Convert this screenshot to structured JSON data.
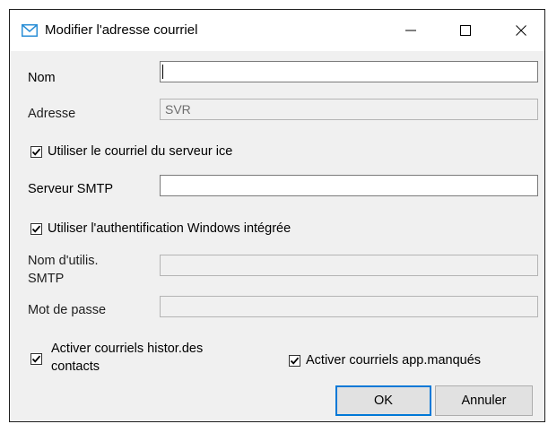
{
  "window": {
    "title": "Modifier l'adresse courriel",
    "controls": {
      "minimize": "minimize-icon",
      "maximize": "maximize-icon",
      "close": "close-icon"
    }
  },
  "form": {
    "nom": {
      "label": "Nom",
      "value": ""
    },
    "adresse": {
      "label": "Adresse",
      "value": "SVR"
    },
    "use_ice_server": {
      "label": "Utiliser le courriel du serveur ice",
      "checked": true
    },
    "smtp_server": {
      "label": "Serveur SMTP",
      "value": ""
    },
    "use_windows_auth": {
      "label": "Utiliser l'authentification Windows intégrée",
      "checked": true
    },
    "smtp_user": {
      "label_line1": "Nom d'utilis.",
      "label_line2": "SMTP",
      "value": ""
    },
    "password": {
      "label": "Mot de passe",
      "value": ""
    },
    "history_emails": {
      "label_line1": "Activer courriels histor.des",
      "label_line2": "contacts",
      "checked": true
    },
    "missed_app_emails": {
      "label": "Activer courriels app.manqués",
      "checked": true
    }
  },
  "buttons": {
    "ok": "OK",
    "cancel": "Annuler"
  },
  "colors": {
    "accent": "#0078d7",
    "window_bg": "#f0f0f0",
    "titlebar_bg": "#ffffff"
  }
}
